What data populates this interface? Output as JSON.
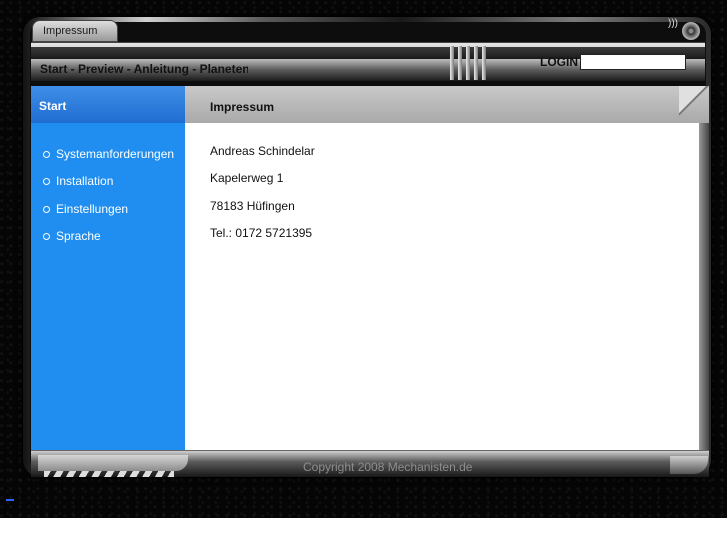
{
  "window": {
    "tab_title": "Impressum",
    "nav_text": "Start - Preview - Anleitung - Planetenr",
    "login_label": "LOGIN",
    "login_value": ""
  },
  "sidebar": {
    "title": "Start",
    "items": [
      {
        "label": "Systemanforderungen"
      },
      {
        "label": "Installation"
      },
      {
        "label": "Einstellungen"
      },
      {
        "label": "Sprache"
      }
    ]
  },
  "content": {
    "title": "Impressum",
    "lines": [
      "Andreas Schindelar",
      "Kapelerweg 1",
      "78183 Hüfingen",
      "Tel.: 0172 5721395"
    ]
  },
  "footer": {
    "copyright": "Copyright 2008 Mechanisten.de"
  },
  "colors": {
    "sidebar_blue": "#1f8ef0",
    "header_gray": "#b4b4b4"
  }
}
